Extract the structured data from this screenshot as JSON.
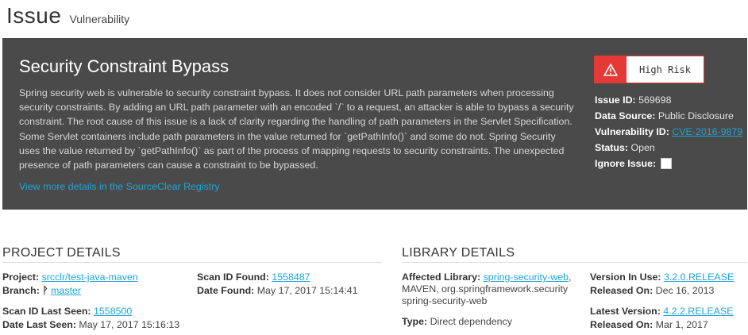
{
  "header": {
    "title": "Issue",
    "subtitle": "Vulnerability"
  },
  "issue": {
    "title": "Security Constraint Bypass",
    "description": "Spring security web is vulnerable to security constraint bypass. It does not consider URL path parameters when processing security constraints. By adding an URL path parameter with an encoded `/` to a request, an attacker is able to bypass a security constraint. The root cause of this issue is a lack of clarity regarding the handling of path parameters in the Servlet Specification. Some Servlet containers include path parameters in the value returned for `getPathInfo()` and some do not. Spring Security uses the value returned by `getPathInfo()` as part of the process of mapping requests to security constraints. The unexpected presence of path parameters can cause a constraint to be bypassed.",
    "registry_link": "View more details in the SourceClear Registry",
    "risk_label": "High Risk",
    "risk_icon": "warning-triangle-icon",
    "risk_color": "#e53935",
    "id_label": "Issue ID:",
    "id_value": "569698",
    "source_label": "Data Source:",
    "source_value": "Public Disclosure",
    "vuln_label": "Vulnerability ID:",
    "vuln_value": "CVE-2016-9879",
    "status_label": "Status:",
    "status_value": "Open",
    "ignore_label": "Ignore Issue:",
    "ignore_checked": false
  },
  "project": {
    "section_title": "PROJECT DETAILS",
    "project_label": "Project:",
    "project_value": "srcclr/test-java-maven",
    "branch_label": "Branch:",
    "branch_icon": "branch-icon",
    "branch_value": "master",
    "scan_found_label": "Scan ID Found:",
    "scan_found_value": "1558487",
    "date_found_label": "Date Found:",
    "date_found_value": "May 17, 2017 15:14:41",
    "scan_last_label": "Scan ID Last Seen:",
    "scan_last_value": "1558500",
    "date_last_label": "Date Last Seen:",
    "date_last_value": "May 17, 2017 15:16:13"
  },
  "library": {
    "section_title": "LIBRARY DETAILS",
    "affected_label": "Affected Library:",
    "affected_link": "spring-security-web",
    "affected_rest": "MAVEN, org.springframework.security spring-security-web",
    "type_label": "Type:",
    "type_value": "Direct dependency",
    "version_label": "Version In Use:",
    "version_value": "3.2.0.RELEASE",
    "released_label": "Released On:",
    "released_value": "Dec 16, 2013",
    "latest_label": "Latest Version:",
    "latest_value": "4.2.2.RELEASE",
    "latest_released_label": "Released On:",
    "latest_released_value": "Mar 1, 2017"
  }
}
